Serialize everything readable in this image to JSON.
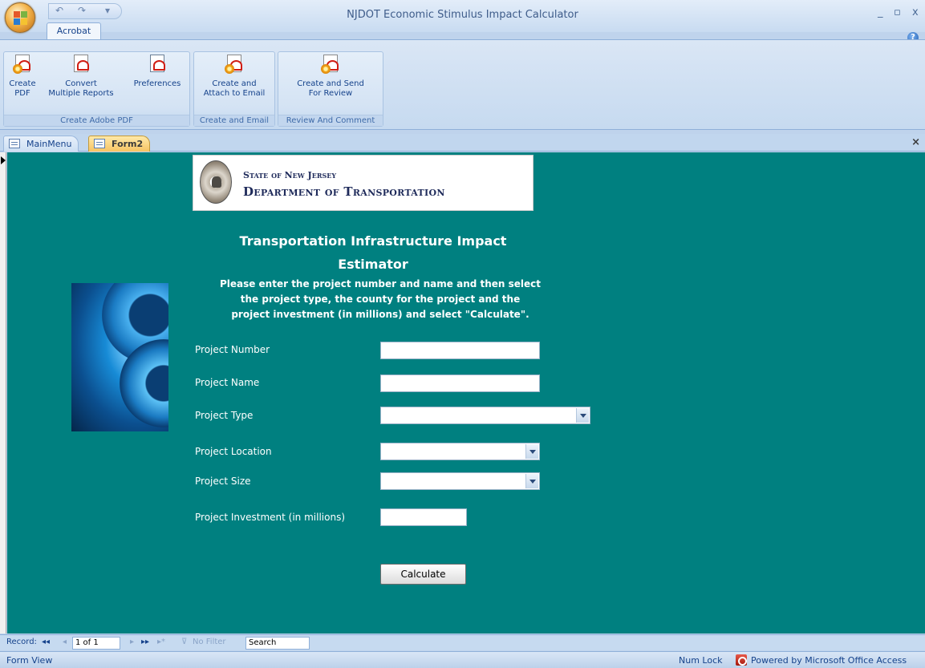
{
  "window": {
    "title": "NJDOT Economic Stimulus Impact Calculator",
    "minimize": "_",
    "restore": "▫",
    "close": "x"
  },
  "quick_access": {
    "undo": "↶",
    "redo": "↷",
    "more": "▾"
  },
  "ribbon": {
    "tab": "Acrobat",
    "groups": [
      {
        "label": "Create Adobe PDF",
        "buttons": [
          {
            "label_l1": "Create",
            "label_l2": "PDF"
          },
          {
            "label_l1": "Convert",
            "label_l2": "Multiple Reports"
          },
          {
            "label_l1": "Preferences",
            "label_l2": ""
          }
        ]
      },
      {
        "label": "Create and Email",
        "buttons": [
          {
            "label_l1": "Create and",
            "label_l2": "Attach to Email"
          }
        ]
      },
      {
        "label": "Review And Comment",
        "buttons": [
          {
            "label_l1": "Create and Send",
            "label_l2": "For Review"
          }
        ]
      }
    ]
  },
  "doc_tabs": [
    {
      "label": "MainMenu",
      "active": false
    },
    {
      "label": "Form2",
      "active": true
    }
  ],
  "doc_close": "×",
  "banner": {
    "line1": "State of New Jersey",
    "line2": "Department of Transportation"
  },
  "form": {
    "heading_line1": "Transportation Infrastructure Impact",
    "heading_line2": "Estimator",
    "instructions": [
      "Please enter the project number and name and then select",
      "the project type, the county for the project and the",
      "project investment (in millions) and select \"Calculate\"."
    ],
    "fields": [
      {
        "label": "Project Number",
        "value": ""
      },
      {
        "label": "Project Name",
        "value": ""
      },
      {
        "label": "Project Type",
        "value": ""
      },
      {
        "label": "Project Location",
        "value": ""
      },
      {
        "label": "Project Size",
        "value": ""
      },
      {
        "label": "Project Investment (in millions)",
        "value": ""
      }
    ],
    "calculate_label": "Calculate"
  },
  "record_nav": {
    "label": "Record:",
    "first": "◂◂",
    "prev": "◂",
    "position": "1 of 1",
    "next": "▸",
    "last": "▸▸",
    "new": "▸*",
    "filter": "No Filter",
    "search": "Search"
  },
  "status": {
    "view": "Form View",
    "numlock": "Num Lock",
    "powered": "Powered by Microsoft Office Access"
  },
  "colors": {
    "form_bg": "#008080",
    "ribbon_bg": "#c6daf0",
    "active_tab": "#f6c363"
  }
}
